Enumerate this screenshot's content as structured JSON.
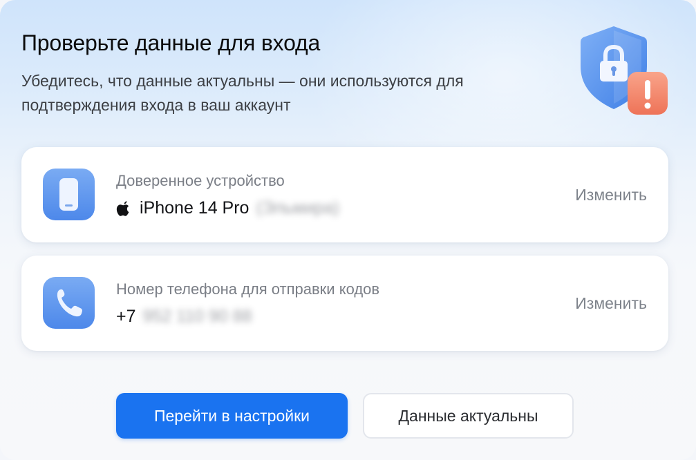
{
  "dialog": {
    "title": "Проверьте данные для входа",
    "subtitle": "Убедитесь, что данные актуальны — они используются для подтверждения входа в ваш аккаунт"
  },
  "hero": {
    "icon": "shield-lock-warning-icon"
  },
  "trusted_device": {
    "icon": "smartphone-icon",
    "label": "Доверенное устройство",
    "brand_icon": "apple-icon",
    "value": "iPhone 14 Pro",
    "blurred_suffix": "(Эльмира)",
    "action": "Изменить"
  },
  "phone": {
    "icon": "phone-handset-icon",
    "label": "Номер телефона для отправки кодов",
    "prefix": "+7",
    "blurred_number": "952 110 90 88",
    "action": "Изменить"
  },
  "buttons": {
    "primary": "Перейти в настройки",
    "secondary": "Данные актуальны"
  },
  "colors": {
    "accent": "#1a73f0",
    "icon_blue": "#5a96ee",
    "warning": "#f28a6f"
  }
}
